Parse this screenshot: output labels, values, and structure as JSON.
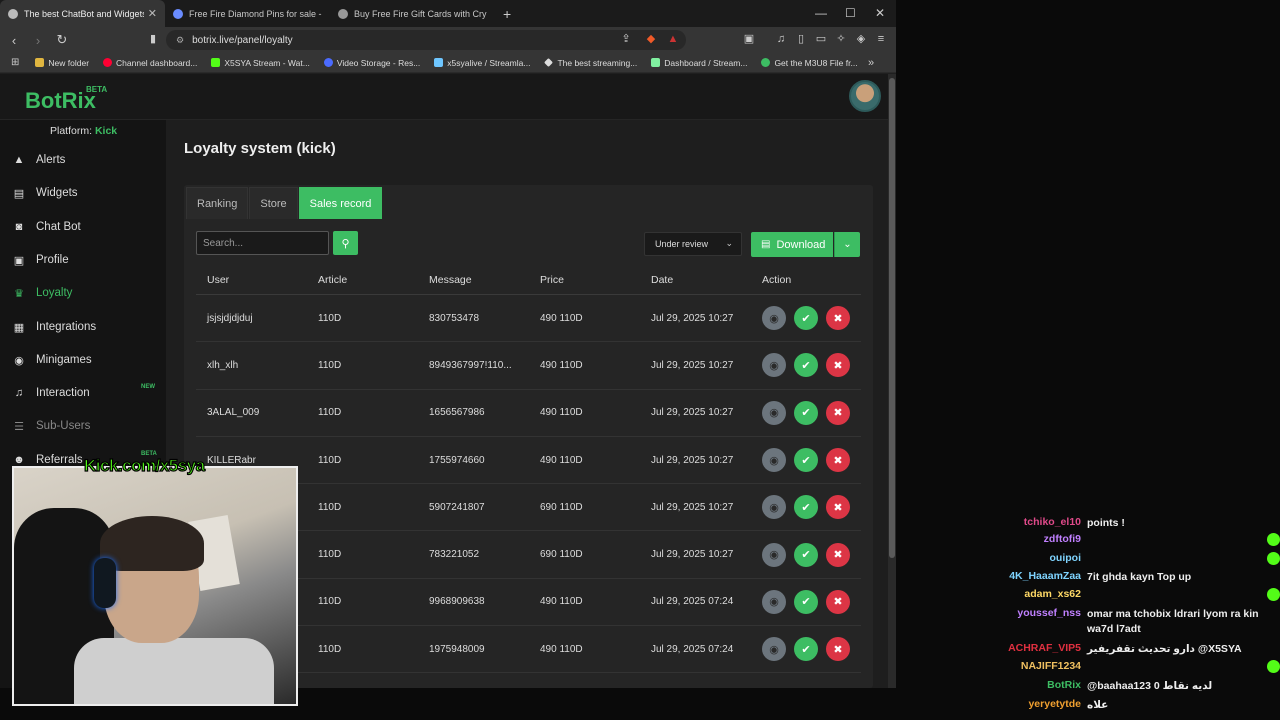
{
  "browser": {
    "tabs": [
      {
        "label": "The best ChatBot and Widgets fo",
        "active": true
      },
      {
        "label": "Free Fire Diamond Pins for sale - Offi",
        "active": false
      },
      {
        "label": "Buy Free Fire Gift Cards with Crypto",
        "active": false
      }
    ],
    "new_tab": "+",
    "url": "botrix.live/panel/loyalty",
    "bookmarks": [
      {
        "label": "New folder",
        "color": "#e0b640"
      },
      {
        "label": "Channel dashboard...",
        "color": "#ff0033"
      },
      {
        "label": "X5SYA Stream - Wat...",
        "color": "#53fc18"
      },
      {
        "label": "Video Storage - Res...",
        "color": "#4b6bff"
      },
      {
        "label": "x5syalive / Streamla...",
        "color": "#6ec6ff"
      },
      {
        "label": "The best streaming...",
        "color": "#dddddd"
      },
      {
        "label": "Dashboard / Stream...",
        "color": "#80f0a0"
      },
      {
        "label": "Get the M3U8 File fr...",
        "color": "#3dbd63"
      }
    ],
    "more_bookmarks": "»"
  },
  "app": {
    "logo": "BotRix",
    "beta": "BETA",
    "platform_label": "Platform:",
    "platform_value": "Kick",
    "accent": "#3dbd63"
  },
  "sidebar": {
    "items": [
      {
        "label": "Alerts",
        "icon": "warning-icon"
      },
      {
        "label": "Widgets",
        "icon": "layout-icon"
      },
      {
        "label": "Chat Bot",
        "icon": "robot-icon"
      },
      {
        "label": "Profile",
        "icon": "id-card-icon"
      },
      {
        "label": "Loyalty",
        "icon": "trophy-icon",
        "active": true
      },
      {
        "label": "Integrations",
        "icon": "plug-icon"
      },
      {
        "label": "Minigames",
        "icon": "gamepad-icon"
      },
      {
        "label": "Interaction",
        "icon": "music-icon",
        "badge": "NEW"
      },
      {
        "label": "Sub-Users",
        "icon": "users-icon",
        "dim": true
      },
      {
        "label": "Referrals",
        "icon": "user-group-icon",
        "badge": "BETA"
      }
    ]
  },
  "main": {
    "title": "Loyalty system (kick)",
    "tabs": [
      "Ranking",
      "Store",
      "Sales record"
    ],
    "active_tab": "Sales record",
    "search_placeholder": "Search...",
    "filter_value": "Under review",
    "download_label": "Download",
    "columns": [
      "User",
      "Article",
      "Message",
      "Price",
      "Date",
      "Action"
    ],
    "rows": [
      {
        "user": "jsjsjdjdjduj",
        "article": "110D",
        "message": "830753478",
        "price": "490 110D",
        "date": "Jul 29, 2025 10:27"
      },
      {
        "user": "xlh_xlh",
        "article": "110D",
        "message": "8949367997!110...",
        "price": "490 110D",
        "date": "Jul 29, 2025 10:27"
      },
      {
        "user": "3ALAL_009",
        "article": "110D",
        "message": "1656567986",
        "price": "490 110D",
        "date": "Jul 29, 2025 10:27"
      },
      {
        "user": "KILLERabr",
        "article": "110D",
        "message": "1755974660",
        "price": "490 110D",
        "date": "Jul 29, 2025 10:27"
      },
      {
        "user": "",
        "article": "110D",
        "message": "5907241807",
        "price": "690 110D",
        "date": "Jul 29, 2025 10:27"
      },
      {
        "user": "",
        "article": "110D",
        "message": "783221052",
        "price": "690 110D",
        "date": "Jul 29, 2025 10:27"
      },
      {
        "user": "",
        "article": "110D",
        "message": "9968909638",
        "price": "490 110D",
        "date": "Jul 29, 2025 07:24"
      },
      {
        "user": "",
        "article": "110D",
        "message": "1975948009",
        "price": "490 110D",
        "date": "Jul 29, 2025 07:24"
      }
    ]
  },
  "overlay": {
    "kick_label": "Kick.com/x5sya",
    "chat": [
      {
        "user": "tchiko_el10",
        "color": "#e04a8a",
        "text": "points !"
      },
      {
        "user": "zdftofi9",
        "color": "#c080ff",
        "text": ""
      },
      {
        "user": "ouipoi",
        "color": "#7fd4ff",
        "text": ""
      },
      {
        "user": "4K_HaaamZaa",
        "color": "#7fd4ff",
        "text": "7it ghda kayn Top up"
      },
      {
        "user": "adam_xs62",
        "color": "#ffd966",
        "text": ""
      },
      {
        "user": "youssef_nss",
        "color": "#c080ff",
        "text": "omar ma tchobix ldrari lyom ra kin wa7d l7adt"
      },
      {
        "user": "ACHRAF_VIP5",
        "color": "#e03040",
        "text": "دارو تحديث تقفريفير @X5SYA"
      },
      {
        "user": "NAJIFF1234",
        "color": "#f0c060",
        "text": ""
      },
      {
        "user": "BotRix",
        "color": "#3dbd63",
        "text": "@baahaa123 لديه نقاط 0"
      },
      {
        "user": "yeryetytde",
        "color": "#f0a030",
        "text": "علاه"
      }
    ]
  }
}
